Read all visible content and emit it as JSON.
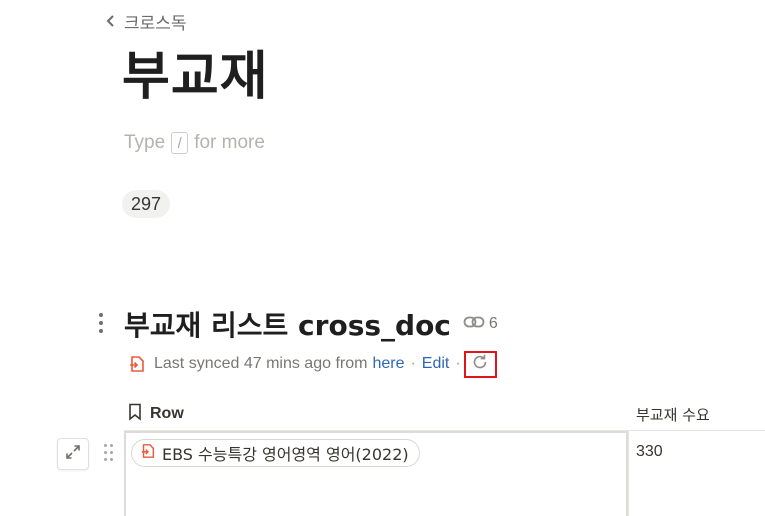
{
  "breadcrumb": {
    "label": "크로스독"
  },
  "page": {
    "title": "부교재",
    "placeholder_prefix": "Type",
    "placeholder_key": "/",
    "placeholder_suffix": "for more",
    "count": "297"
  },
  "database": {
    "title": "부교재 리스트 cross_doc",
    "link_count": "6",
    "sync": {
      "text": "Last synced 47 mins ago from",
      "here_label": "here",
      "separator": "·",
      "edit_label": "Edit"
    },
    "columns": [
      {
        "label": "Row"
      },
      {
        "label": "부교재 수요"
      }
    ],
    "rows": [
      {
        "name": "EBS 수능특강 영어영역 영어(2022)",
        "demand": "330"
      }
    ]
  },
  "colors": {
    "accent_link": "#2f67b5",
    "highlight_border": "#e0141b",
    "sync_icon": "#eb5a3c"
  },
  "icons": {
    "breadcrumb": "chevron-left-icon",
    "link": "link-icon",
    "sync": "synced-block-icon",
    "refresh": "refresh-icon",
    "row_column": "bookmark-icon",
    "expand": "expand-icon",
    "drag": "drag-handle-icon"
  }
}
